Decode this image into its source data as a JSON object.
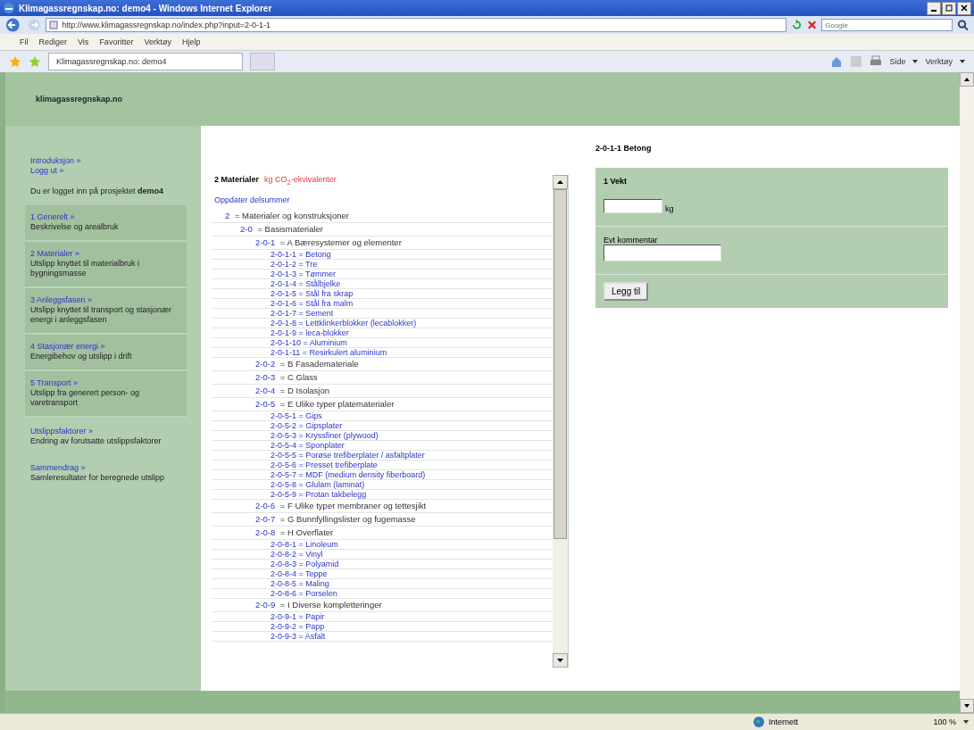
{
  "window": {
    "title": "Klimagassregnskap.no: demo4 - Windows Internet Explorer"
  },
  "address_bar": {
    "url": "http://www.klimagassregnskap.no/index.php?input=2-0-1-1"
  },
  "search": {
    "placeholder": "Google"
  },
  "menu": [
    "Fil",
    "Rediger",
    "Vis",
    "Favoritter",
    "Verktøy",
    "Hjelp"
  ],
  "tab": {
    "title": "Klimagassregnskap.no: demo4"
  },
  "toolbar": [
    "Side",
    "Verktøy"
  ],
  "site": {
    "name": "klimagassregnskap.no"
  },
  "sidebar": {
    "links": [
      "Introduksjon »",
      "Logg ut »"
    ],
    "login_note": "Du er logget inn på prosjektet **demo4**",
    "items": [
      {
        "title": "1 Generelt »",
        "description": "Beskrivelse og arealbruk",
        "boxed": true
      },
      {
        "title": "2 Materialer »",
        "description": "Utslipp knyttet til materialbruk i bygningsmasse",
        "boxed": true
      },
      {
        "title": "3 Anleggsfasen »",
        "description": "Utslipp knyttet til transport og stasjonær energi i anleggsfasen",
        "boxed": true
      },
      {
        "title": "4 Stasjonær energi »",
        "description": "Energibehov og utslipp i drift",
        "boxed": true
      },
      {
        "title": "5 Transport »",
        "description": "Utslipp fra generert person- og varetransport",
        "boxed": true
      },
      {
        "title": "Utslippsfaktorer »",
        "description": "Endring av forutsatte utslippsfaktorer",
        "boxed": false
      },
      {
        "title": "Sammendrag »",
        "description": "Samleresultater for beregnede utslipp",
        "boxed": false
      }
    ]
  },
  "materials": {
    "heading": "2 Materialer",
    "unit": "kg CO$_{2}$-ekvivalenter",
    "update_link": "Oppdater delsummer",
    "tree": [
      {
        "code": "2",
        "text": "= Materialer og konstruksjoner",
        "children": [
          {
            "code": "2-0",
            "text": "= Basismaterialer",
            "children": [
              {
                "code": "2-0-1",
                "text": "= A Bæresystemer og elementer",
                "children": [
                  {
                    "code": "2-0-1-1",
                    "text": "= Betong"
                  },
                  {
                    "code": "2-0-1-2",
                    "text": "= Tre"
                  },
                  {
                    "code": "2-0-1-3",
                    "text": "= Tømmer"
                  },
                  {
                    "code": "2-0-1-4",
                    "text": "= Stålbjelke"
                  },
                  {
                    "code": "2-0-1-5",
                    "text": "= Stål fra skrap"
                  },
                  {
                    "code": "2-0-1-6",
                    "text": "= Stål fra malm"
                  },
                  {
                    "code": "2-0-1-7",
                    "text": "= Sement"
                  },
                  {
                    "code": "2-0-1-8",
                    "text": "= Lettklinkerblokker (lecablokker)"
                  },
                  {
                    "code": "2-0-1-9",
                    "text": "= leca-blokker"
                  },
                  {
                    "code": "2-0-1-10",
                    "text": "= Aluminium"
                  },
                  {
                    "code": "2-0-1-11",
                    "text": "= Resirkulert aluminium"
                  }
                ]
              },
              {
                "code": "2-0-2",
                "text": "= B Fasademateriale"
              },
              {
                "code": "2-0-3",
                "text": "= C Glass"
              },
              {
                "code": "2-0-4",
                "text": "= D Isolasjon"
              },
              {
                "code": "2-0-5",
                "text": "= E Ulike typer platematerialer",
                "children": [
                  {
                    "code": "2-0-5-1",
                    "text": "= Gips"
                  },
                  {
                    "code": "2-0-5-2",
                    "text": "= Gipsplater"
                  },
                  {
                    "code": "2-0-5-3",
                    "text": "= Kryssfiner (plywood)"
                  },
                  {
                    "code": "2-0-5-4",
                    "text": "= Sponplater"
                  },
                  {
                    "code": "2-0-5-5",
                    "text": "= Porøse trefiberplater / asfaltplater"
                  },
                  {
                    "code": "2-0-5-6",
                    "text": "= Presset trefiberplate"
                  },
                  {
                    "code": "2-0-5-7",
                    "text": "= MDF (medium density fiberboard)"
                  },
                  {
                    "code": "2-0-5-8",
                    "text": "= Glulam (laminat)"
                  },
                  {
                    "code": "2-0-5-9",
                    "text": "= Protan takbelegg"
                  }
                ]
              },
              {
                "code": "2-0-6",
                "text": "= F Ulike typer membraner og tettesjikt"
              },
              {
                "code": "2-0-7",
                "text": "= G Bunnfyllingslister og fugemasse"
              },
              {
                "code": "2-0-8",
                "text": "= H Overflater",
                "children": [
                  {
                    "code": "2-0-8-1",
                    "text": "= Linoleum"
                  },
                  {
                    "code": "2-0-8-2",
                    "text": "= Vinyl"
                  },
                  {
                    "code": "2-0-8-3",
                    "text": "= Polyamid"
                  },
                  {
                    "code": "2-0-8-4",
                    "text": "= Teppe"
                  },
                  {
                    "code": "2-0-8-5",
                    "text": "= Maling"
                  },
                  {
                    "code": "2-0-8-6",
                    "text": "= Porselen"
                  }
                ]
              },
              {
                "code": "2-0-9",
                "text": "= I Diverse kompletteringer",
                "children": [
                  {
                    "code": "2-0-9-1",
                    "text": "= Papir"
                  },
                  {
                    "code": "2-0-9-2",
                    "text": "= Papp"
                  },
                  {
                    "code": "2-0-9-3",
                    "text": "= Asfalt"
                  }
                ]
              }
            ]
          }
        ]
      }
    ]
  },
  "detail": {
    "heading": "2-0-1-1 Betong",
    "section": "1 Vekt",
    "unit": "kg",
    "comment_label": "Evt kommentar",
    "button": "Legg til"
  },
  "status_bar": {
    "zone": "Internett",
    "zoom": "100 %"
  }
}
